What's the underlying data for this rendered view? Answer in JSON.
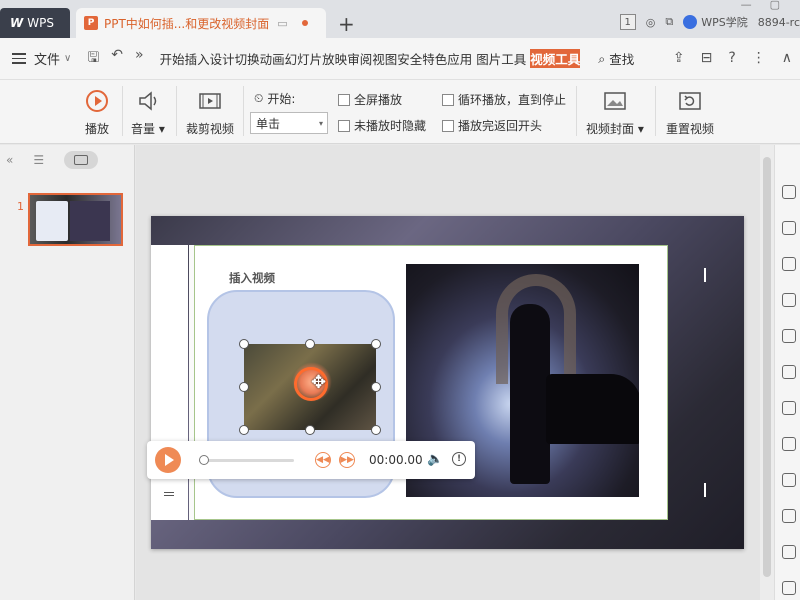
{
  "tabs": {
    "app_label": "WPS",
    "doc_title": "PPT中如何插...和更改视频封面",
    "doc_icon_letter": "P"
  },
  "tabbar_right": {
    "badge": "1",
    "wps_college": "WPS学院",
    "account": "8894-rc"
  },
  "menu": {
    "file_label": "文件",
    "items": [
      "开始",
      "插入",
      "设计",
      "切换",
      "动画",
      "幻灯片放映",
      "审阅",
      "视图",
      "安全",
      "特色应用",
      "图片工具"
    ],
    "active_item": "视频工具",
    "search_label": "查找"
  },
  "ribbon": {
    "play_label": "播放",
    "volume_label": "音量",
    "trim_label": "裁剪视频",
    "start_label": "开始:",
    "start_value": "单击",
    "fullscreen_label": "全屏播放",
    "hide_label": "未播放时隐藏",
    "loop_label": "循环播放，直到停止",
    "rewind_label": "播放完返回开头",
    "cover_label": "视频封面",
    "reset_label": "重置视频"
  },
  "slides": {
    "number": "1"
  },
  "slide": {
    "title": "插入视频"
  },
  "player": {
    "time": "00:00.00"
  },
  "colors": {
    "accent": "#e2673a",
    "player_accent": "#ef8a55"
  }
}
